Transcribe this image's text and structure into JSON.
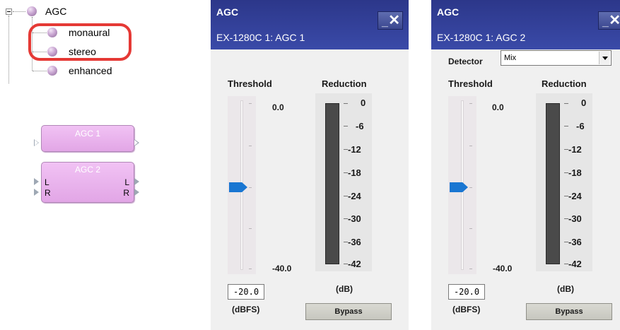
{
  "tree": {
    "root": "AGC",
    "children": [
      "monaural",
      "stereo",
      "enhanced"
    ]
  },
  "blocks": [
    {
      "title": "AGC 1"
    },
    {
      "title": "AGC 2",
      "inputs": [
        "L",
        "R"
      ],
      "outputs": [
        "L",
        "R"
      ]
    }
  ],
  "windows": [
    {
      "title": "AGC",
      "subtitle": "EX-1280C 1: AGC 1",
      "threshold_label": "Threshold",
      "reduction_label": "Reduction",
      "slider_max": "0.0",
      "slider_min": "-40.0",
      "threshold_value": "-20.0",
      "threshold_unit": "(dBFS)",
      "reduction_unit": "(dB)",
      "meter_labels": [
        "0",
        "-6",
        "-12",
        "-18",
        "-24",
        "-30",
        "-36",
        "-42"
      ],
      "bypass_label": "Bypass"
    },
    {
      "title": "AGC",
      "subtitle": "EX-1280C 1: AGC 2",
      "detector_label": "Detector",
      "detector_value": "Mix",
      "threshold_label": "Threshold",
      "reduction_label": "Reduction",
      "slider_max": "0.0",
      "slider_min": "-40.0",
      "threshold_value": "-20.0",
      "threshold_unit": "(dBFS)",
      "reduction_unit": "(dB)",
      "meter_labels": [
        "0",
        "-6",
        "-12",
        "-18",
        "-24",
        "-30",
        "-36",
        "-42"
      ],
      "bypass_label": "Bypass"
    }
  ],
  "colors": {
    "title_bar": "#2c378a",
    "module_block": "#e8b0ec",
    "highlight": "#e53935",
    "slider_thumb": "#1976d2"
  }
}
